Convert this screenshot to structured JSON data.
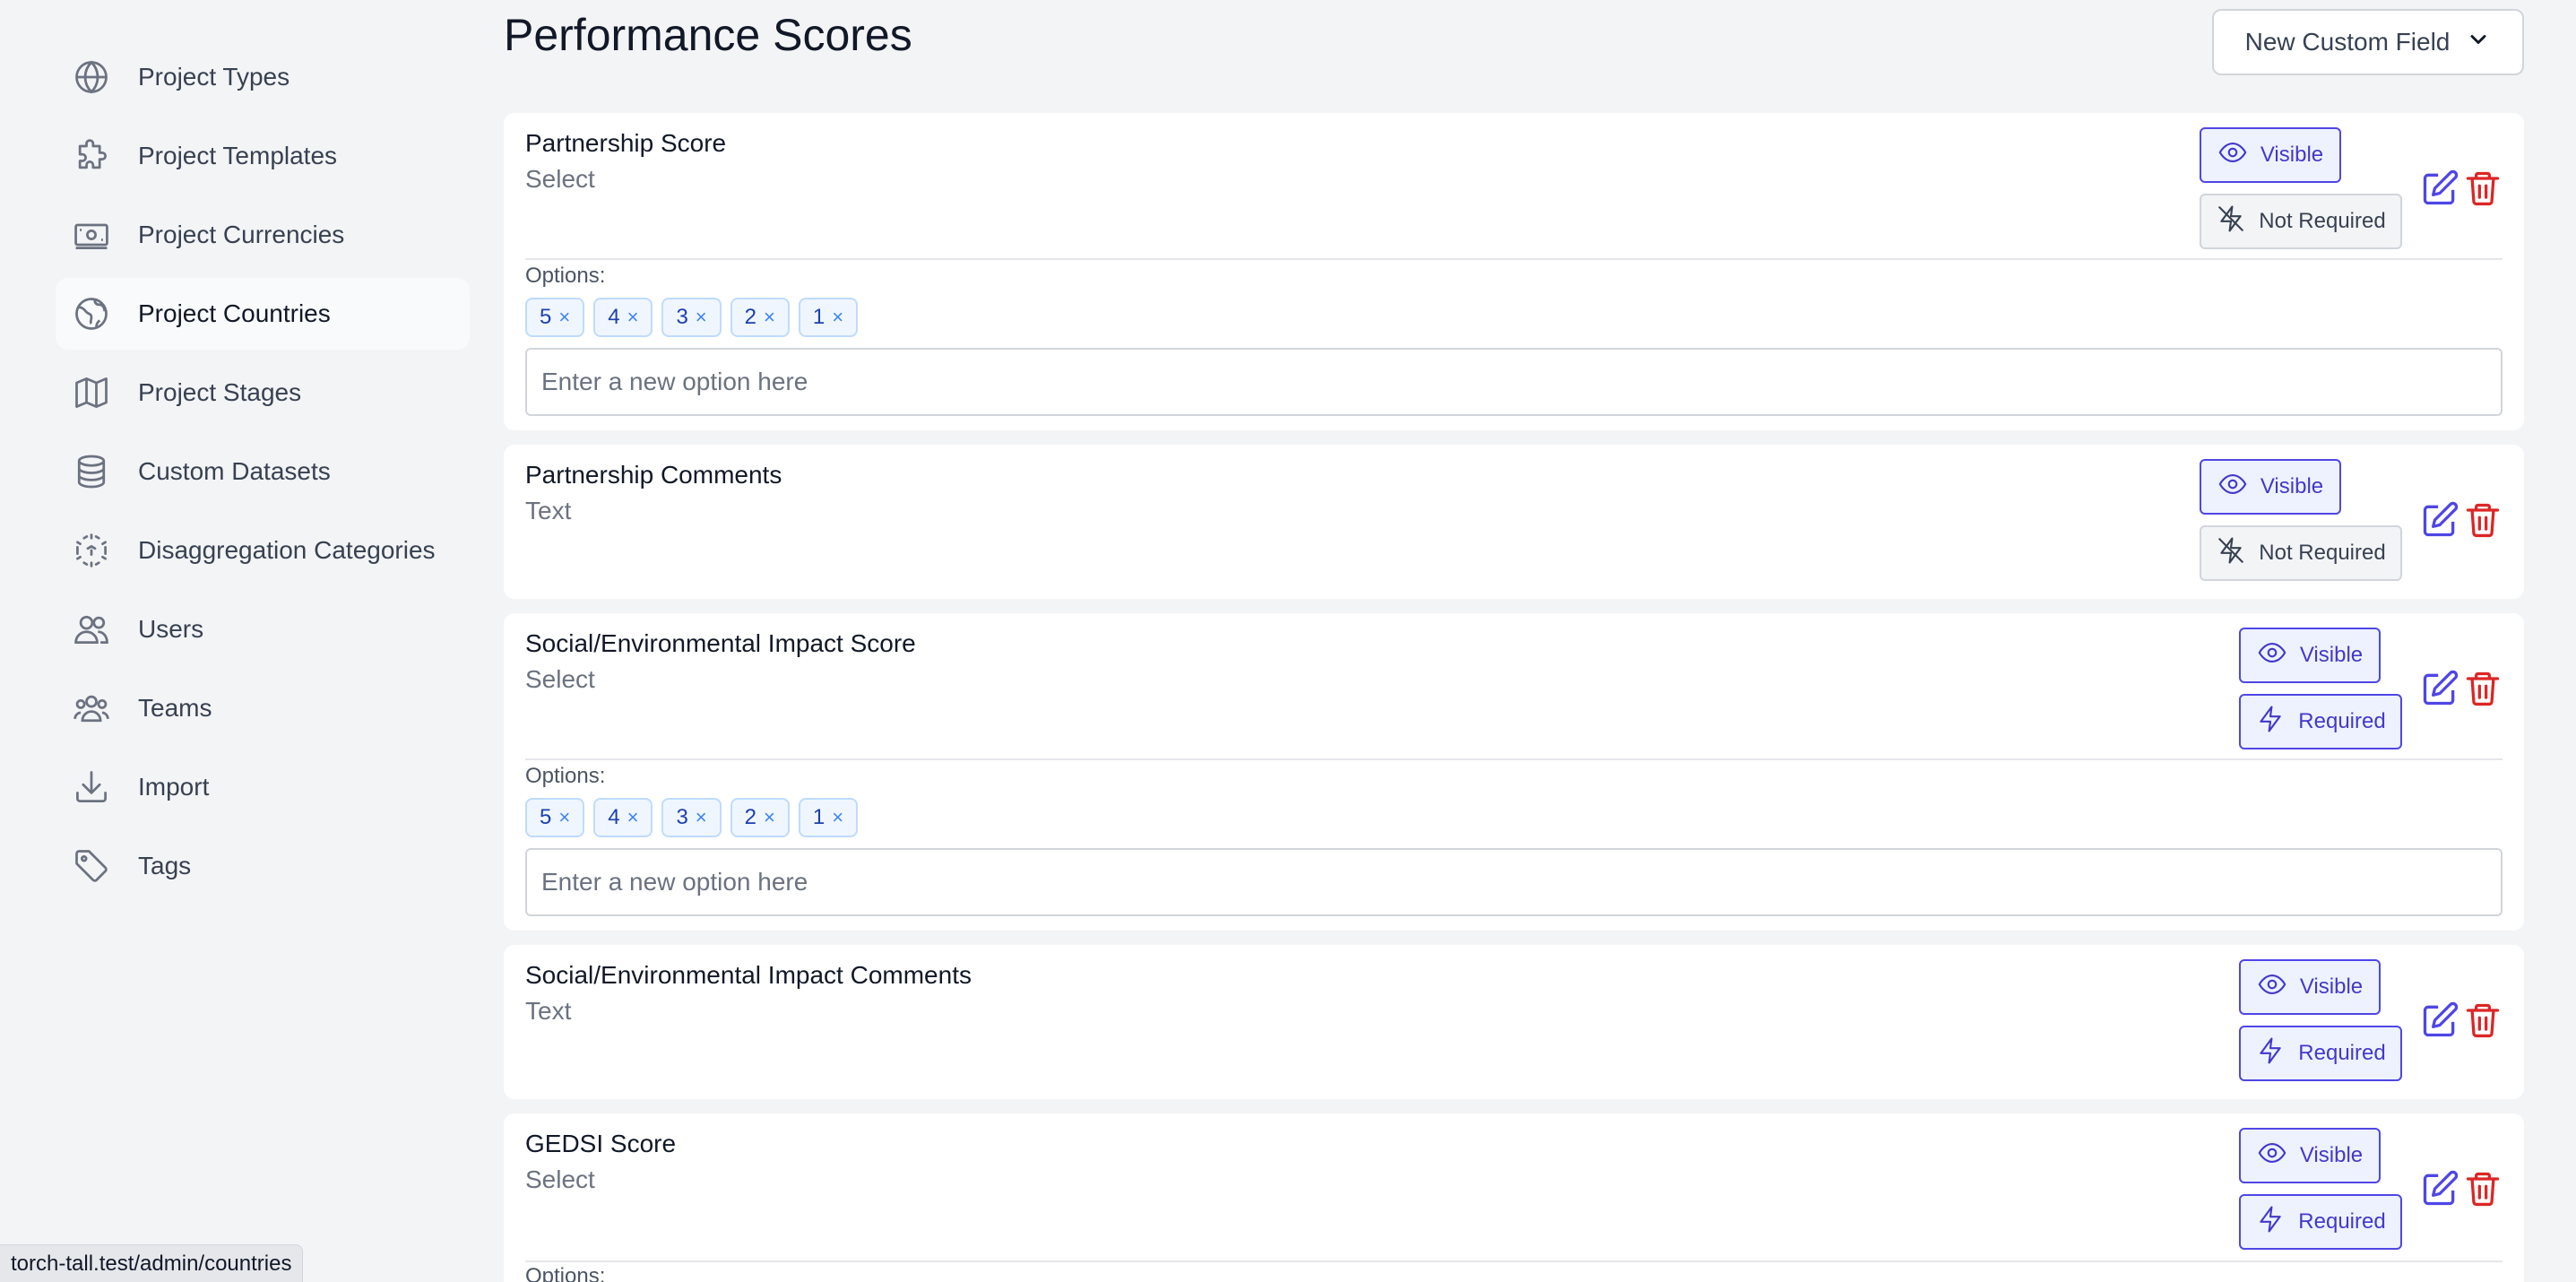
{
  "sidebar": {
    "items": [
      {
        "label": "Project Types",
        "icon": "globe-icon"
      },
      {
        "label": "Project Templates",
        "icon": "puzzle-icon"
      },
      {
        "label": "Project Currencies",
        "icon": "cash-icon"
      },
      {
        "label": "Project Countries",
        "icon": "globe-alt-icon",
        "active": true
      },
      {
        "label": "Project Stages",
        "icon": "map-icon"
      },
      {
        "label": "Custom Datasets",
        "icon": "database-icon"
      },
      {
        "label": "Disaggregation Categories",
        "icon": "cube-transparent-icon"
      },
      {
        "label": "Users",
        "icon": "users-icon"
      },
      {
        "label": "Teams",
        "icon": "user-group-icon"
      },
      {
        "label": "Import",
        "icon": "download-icon"
      },
      {
        "label": "Tags",
        "icon": "tag-icon"
      }
    ]
  },
  "header": {
    "title": "Performance Scores",
    "new_field_label": "New Custom Field"
  },
  "fields": [
    {
      "name": "Partnership Score",
      "type": "Select",
      "visible_label": "Visible",
      "required_label": "Not Required",
      "options_label": "Options:",
      "options": [
        "5",
        "4",
        "3",
        "2",
        "1"
      ],
      "placeholder": "Enter a new option here"
    },
    {
      "name": "Partnership Comments",
      "type": "Text",
      "visible_label": "Visible",
      "required_label": "Not Required"
    },
    {
      "name": "Social/Environmental Impact Score",
      "type": "Select",
      "visible_label": "Visible",
      "required_label": "Required",
      "options_label": "Options:",
      "options": [
        "5",
        "4",
        "3",
        "2",
        "1"
      ],
      "placeholder": "Enter a new option here"
    },
    {
      "name": "Social/Environmental Impact Comments",
      "type": "Text",
      "visible_label": "Visible",
      "required_label": "Required"
    },
    {
      "name": "GEDSI Score",
      "type": "Select",
      "visible_label": "Visible",
      "required_label": "Required",
      "options_label": "Options:"
    }
  ],
  "chip_remove": "×",
  "status_bar": {
    "url": "torch-tall.test/admin/countries"
  },
  "colors": {
    "accent": "#4f46e5",
    "danger": "#dc2626",
    "chip_bg": "#eff6ff"
  }
}
